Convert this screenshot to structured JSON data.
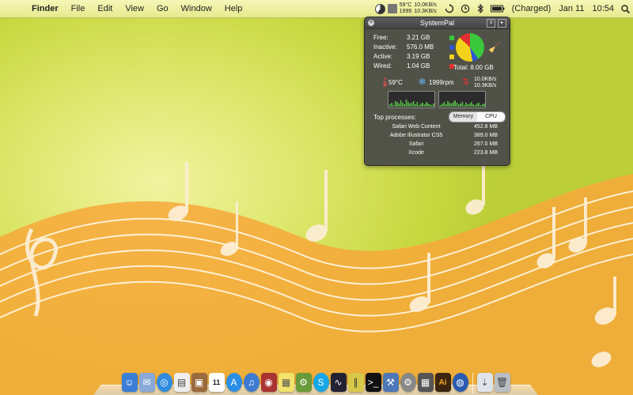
{
  "menubar": {
    "app_name": "Finder",
    "menus": [
      "File",
      "Edit",
      "View",
      "Go",
      "Window",
      "Help"
    ],
    "status": {
      "temp": "59°C",
      "rpm": "1999",
      "net_in": "10.0KB/s",
      "net_out": "10.3KB/s",
      "battery": "(Charged)",
      "date": "Jan 11",
      "time": "10:54"
    }
  },
  "systempal": {
    "title": "SystemPal",
    "memory": [
      {
        "label": "Free:",
        "value": "3.21 GB",
        "color": "#3cc83c"
      },
      {
        "label": "Inactive:",
        "value": "576.0 MB",
        "color": "#2f55d6"
      },
      {
        "label": "Active:",
        "value": "3.19 GB",
        "color": "#f2d21b"
      },
      {
        "label": "Wired:",
        "value": "1.04 GB",
        "color": "#e23030"
      }
    ],
    "total": "Total: 8.00 GB",
    "temp": "59°C",
    "rpm": "1999rpm",
    "net_in": "10.0KB/s",
    "net_out": "10.3KB/s",
    "top_processes_label": "Top processes:",
    "tabs": {
      "memory": "Memory",
      "cpu": "CPU"
    },
    "processes": [
      {
        "name": "Safari Web Content",
        "size": "452.8 MB"
      },
      {
        "name": "Adobe Illustrator CS5",
        "size": "389.0 MB"
      },
      {
        "name": "Safari",
        "size": "267.0 MB"
      },
      {
        "name": "Xcode",
        "size": "223.8 MB"
      }
    ]
  },
  "dock": {
    "icons": [
      "finder-icon",
      "mail-stamp-icon",
      "safari-icon",
      "preview-icon",
      "photos-icon",
      "calendar-icon",
      "app-store-icon",
      "itunes-icon",
      "photo-booth-icon",
      "stickies-icon",
      "automator-icon",
      "skype-icon",
      "activity-monitor-icon",
      "parallels-icon",
      "terminal-icon",
      "xcode-icon",
      "system-preferences-icon",
      "calculator-icon",
      "illustrator-icon",
      "firefox-icon",
      "downloads-icon",
      "trash-icon"
    ],
    "calendar_day": "11",
    "illustrator_label": "Ai"
  }
}
